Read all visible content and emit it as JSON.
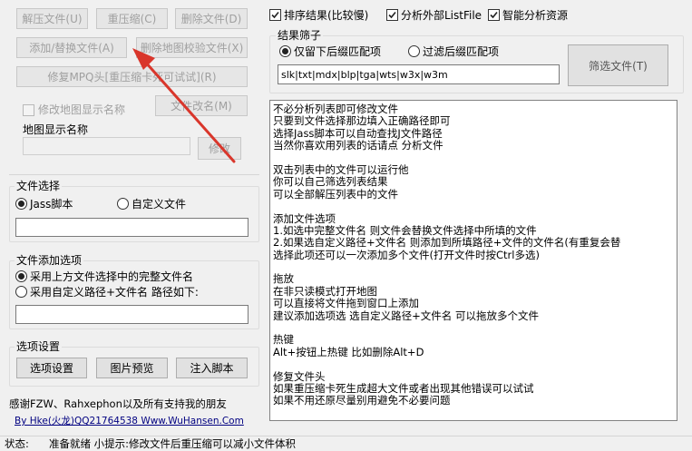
{
  "top_buttons": {
    "decompress": "解压文件(U)",
    "recompress": "重压缩(C)",
    "delete_file": "删除文件(D)",
    "add_replace": "添加/替换文件(A)",
    "delete_map_verify": "删除地图校验文件(X)",
    "repair_mpq": "修复MPQ头[重压缩卡死可试试](R)",
    "rename_file": "文件改名(M)"
  },
  "map_name": {
    "checkbox_label": "修改地图显示名称",
    "field_label": "地图显示名称",
    "value": "",
    "modify_button": "修改"
  },
  "file_select": {
    "title": "文件选择",
    "option_jass": "Jass脚本",
    "option_custom": "自定义文件",
    "path_value": ""
  },
  "add_options": {
    "title": "文件添加选项",
    "option_full": "采用上方文件选择中的完整文件名",
    "option_custom": "采用自定义路径+文件名 路径如下:",
    "path_value": ""
  },
  "settings": {
    "title": "选项设置",
    "options_button": "选项设置",
    "preview_button": "图片预览",
    "inject_button": "注入脚本"
  },
  "credits": {
    "line1": "感谢FZW、Rahxephon以及所有支持我的朋友",
    "line2": "By Hke(火龙)QQ21764538 Www.WuHansen.Com"
  },
  "top_checks": {
    "sort": "排序结果(比较慢)",
    "analyze_listfile": "分析外部ListFile",
    "smart_analyze": "智能分析资源"
  },
  "filter": {
    "title": "结果筛子",
    "keep_option": "仅留下后缀匹配项",
    "exclude_option": "过滤后缀匹配项",
    "extensions": "slk|txt|mdx|blp|tga|wts|w3x|w3m",
    "filter_button": "筛选文件(T)"
  },
  "help_text": [
    "不必分析列表即可修改文件",
    "只要到文件选择那边填入正确路径即可",
    "选择Jass脚本可以自动查找J文件路径",
    "当然你喜欢用列表的话请点 分析文件",
    "",
    "双击列表中的文件可以运行他",
    "你可以自己筛选列表结果",
    "可以全部解压列表中的文件",
    "",
    "添加文件选项",
    "1.如选中完整文件名 则文件会替换文件选择中所填的文件",
    "2.如果选自定义路径+文件名 则添加到所填路径+文件的文件名(有重复会替",
    "  选择此项还可以一次添加多个文件(打开文件时按Ctrl多选)",
    "",
    "拖放",
    "在非只读模式打开地图",
    "可以直接将文件拖到窗口上添加",
    "建议添加选项选 选自定义路径+文件名 可以拖放多个文件",
    "",
    "热键",
    "Alt+按钮上热键 比如删除Alt+D",
    "",
    "修复文件头",
    "如果重压缩卡死生成超大文件或者出现其他错误可以试试",
    "如果不用还原尽量别用避免不必要问题"
  ],
  "status_bar": {
    "label": "状态:",
    "message": "准备就绪 小提示:修改文件后重压缩可以减小文件体积"
  },
  "colors": {
    "annotation_arrow": "#d9362b",
    "credit_link": "#000080"
  }
}
